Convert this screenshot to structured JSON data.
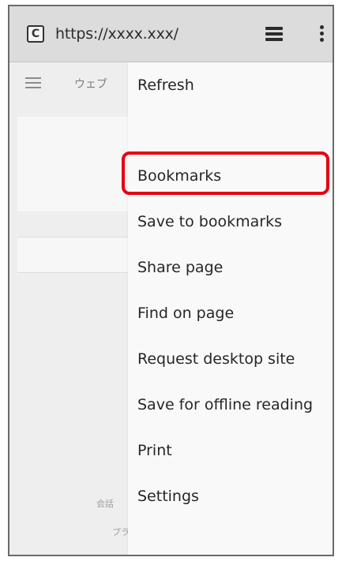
{
  "address_bar": {
    "site_icon_glyph": "C",
    "url": "https://xxxx.xxx/"
  },
  "page": {
    "web_label": "ウェブ",
    "footer_line1": "会話",
    "footer_line2": "プライバシーと利用規約"
  },
  "menu": {
    "items": [
      {
        "label": "Refresh"
      },
      {
        "label": ""
      },
      {
        "label": "Bookmarks",
        "highlighted": true
      },
      {
        "label": "Save to bookmarks"
      },
      {
        "label": "Share page"
      },
      {
        "label": "Find on page"
      },
      {
        "label": "Request desktop site"
      },
      {
        "label": "Save for offline reading"
      },
      {
        "label": "Print"
      },
      {
        "label": "Settings"
      }
    ]
  },
  "colors": {
    "highlight": "#e60012"
  }
}
